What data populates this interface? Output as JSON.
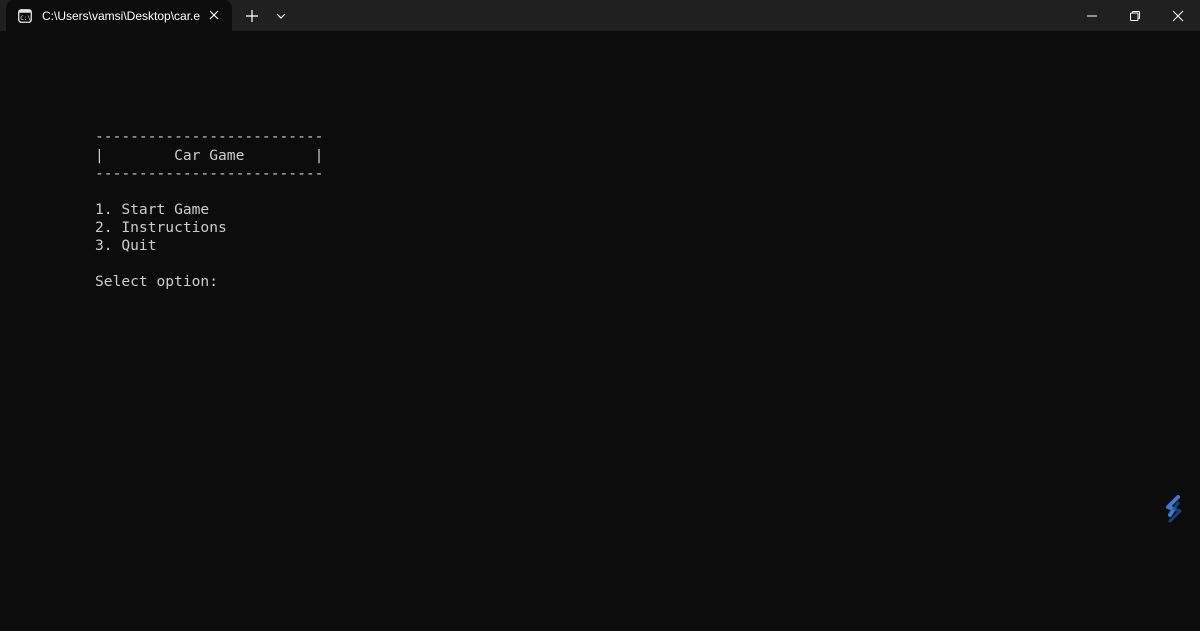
{
  "titlebar": {
    "tab_title": "C:\\Users\\vamsi\\Desktop\\car.e",
    "tab_icon": "terminal-icon",
    "close_tab_icon": "close-icon",
    "new_tab_icon": "plus-icon",
    "dropdown_icon": "chevron-down-icon",
    "window_controls": [
      "minimize-icon",
      "restore-icon",
      "close-icon"
    ]
  },
  "console": {
    "border_top": "--------------------------",
    "title_line": "|        Car Game        |",
    "border_bottom": "--------------------------",
    "menu": [
      "1. Start Game",
      "2. Instructions",
      "3. Quit"
    ],
    "prompt": "Select option:"
  },
  "colors": {
    "background": "#0c0c0c",
    "titlebar": "#202020",
    "text": "#cccccc",
    "widget_accent": "#3a7bd5"
  }
}
